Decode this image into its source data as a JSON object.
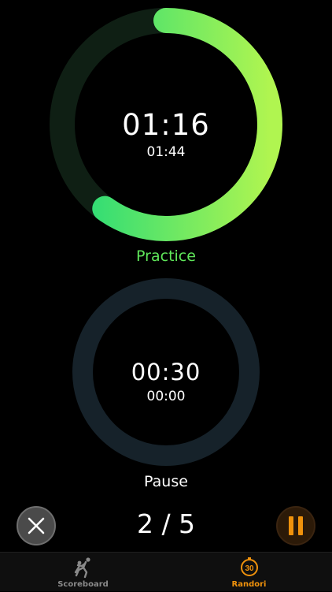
{
  "practice": {
    "remaining": "01:16",
    "total": "01:44",
    "label": "Practice",
    "progress": 0.6,
    "color": "#5fe65a"
  },
  "pause": {
    "remaining": "00:30",
    "total": "00:00",
    "label": "Pause",
    "progress": 0,
    "color": "#16222a"
  },
  "controls": {
    "round_counter": "2 / 5",
    "cancel_icon": "close-icon",
    "pause_icon": "pause-icon",
    "pause_color": "#f0920c"
  },
  "tabbar": {
    "tabs": [
      {
        "label": "Scoreboard",
        "icon": "judo-throw-icon",
        "active": false,
        "color": "#8a8a8a"
      },
      {
        "label": "Randori",
        "icon": "randori-timer-icon",
        "active": true,
        "color": "#f0920c"
      }
    ]
  }
}
